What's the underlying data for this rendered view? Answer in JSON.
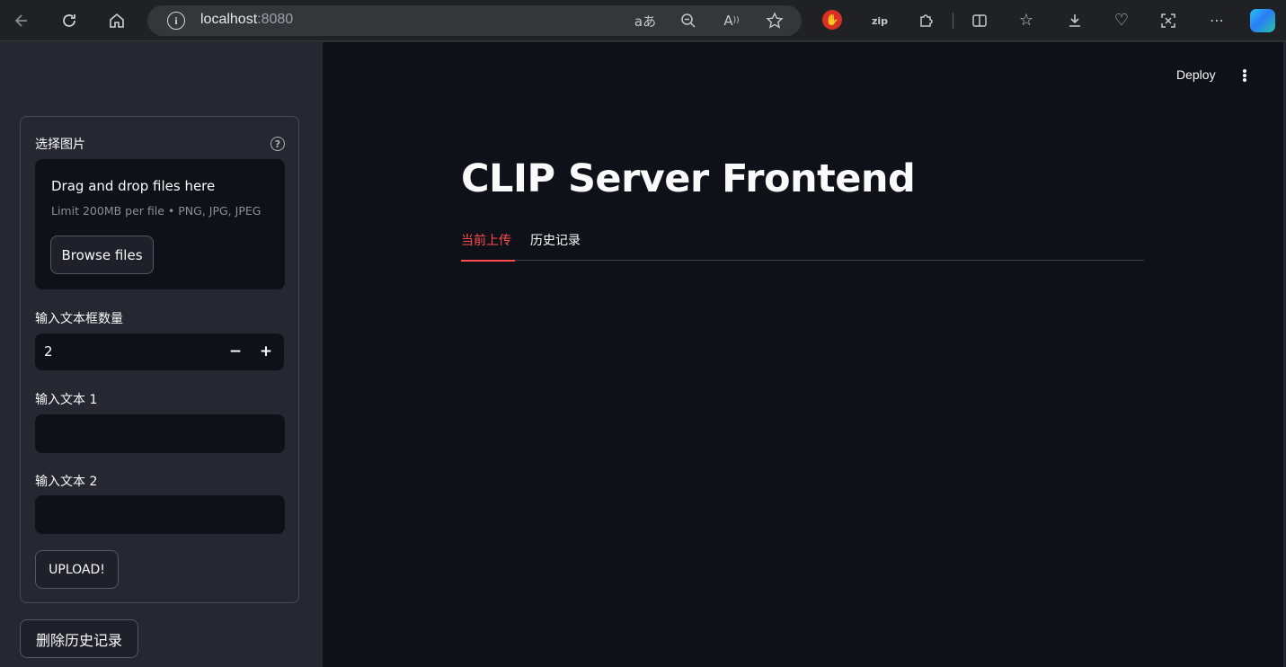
{
  "browser": {
    "url_host": "localhost",
    "url_port": ":8080",
    "icons": [
      "back-icon",
      "refresh-icon",
      "home-icon",
      "info-icon",
      "read-aloud-icon",
      "zoom-out-icon",
      "text-size-icon",
      "favorite-star-icon",
      "extension-red-icon",
      "zip-extension-icon",
      "extensions-puzzle-icon",
      "split-screen-icon",
      "favorites-icon",
      "downloads-icon",
      "browser-essentials-icon",
      "screenshot-icon",
      "more-icon",
      "copilot-icon"
    ]
  },
  "sidebar": {
    "image_label": "选择图片",
    "dropzone_title": "Drag and drop files here",
    "dropzone_limit": "Limit 200MB per file • PNG, JPG, JPEG",
    "browse_label": "Browse files",
    "count_label": "输入文本框数量",
    "count_value": "2",
    "minus": "−",
    "plus": "+",
    "text1_label": "输入文本 1",
    "text1_value": "",
    "text2_label": "输入文本 2",
    "text2_value": "",
    "upload_label": "UPLOAD!",
    "delete_history_label": "删除历史记录"
  },
  "header": {
    "deploy_label": "Deploy"
  },
  "main": {
    "title": "CLIP Server Frontend",
    "tabs": [
      {
        "label": "当前上传",
        "active": true
      },
      {
        "label": "历史记录",
        "active": false
      }
    ]
  },
  "colors": {
    "accent": "#ff4b4b",
    "background": "#0e1117",
    "sidebar": "#262730"
  }
}
